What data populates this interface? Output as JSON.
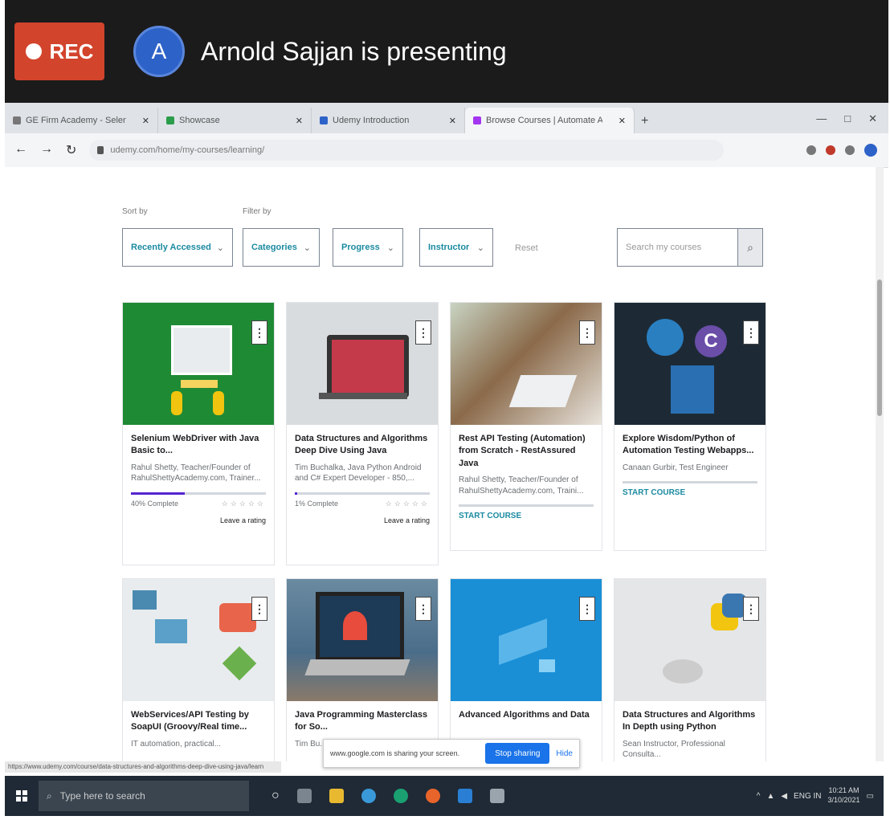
{
  "meeting": {
    "rec_label": "REC",
    "avatar_letter": "A",
    "presenting_text": "Arnold Sajjan is presenting"
  },
  "browser": {
    "tabs": [
      {
        "title": "GE Firm Academy - Selenium Co...",
        "active": false
      },
      {
        "title": "Showcase",
        "active": false
      },
      {
        "title": "Udemy Introduction",
        "active": false
      },
      {
        "title": "Browse Courses | Automate Aspir...",
        "active": true
      }
    ],
    "new_tab": "+",
    "url": "udemy.com/home/my-courses/learning/"
  },
  "filters": {
    "sort_label": "Sort by",
    "filter_label": "Filter by",
    "sort_value": "Recently Accessed",
    "categories": "Categories",
    "progress": "Progress",
    "instructor": "Instructor",
    "reset": "Reset",
    "search_placeholder": "Search my courses"
  },
  "courses": [
    {
      "title": "Selenium WebDriver with Java Basic to...",
      "author": "Rahul Shetty, Teacher/Founder of RahulShettyAcademy.com, Trainer...",
      "progress_pct": 40,
      "status": "40% Complete",
      "rating_label": "Leave a rating",
      "thumb_color": "#1f8a34"
    },
    {
      "title": "Data Structures and Algorithms Deep Dive Using Java",
      "author": "Tim Buchalka, Java Python Android and C# Expert Developer - 850,...",
      "progress_pct": 1,
      "status": "1% Complete",
      "rating_label": "Leave a rating",
      "thumb_color": "#d9dcdf"
    },
    {
      "title": "Rest API Testing (Automation) from Scratch - RestAssured Java",
      "author": "Rahul Shetty, Teacher/Founder of RahulShettyAcademy.com, Traini...",
      "progress_pct": 0,
      "status": "START COURSE",
      "rating_label": "",
      "thumb_color": "#8a6a4a"
    },
    {
      "title": "Explore Wisdom/Python of Automation Testing Webapps...",
      "author": "Canaan Gurbir, Test Engineer",
      "progress_pct": 0,
      "status": "START COURSE",
      "rating_label": "",
      "thumb_color": "#1d2a36"
    },
    {
      "title": "WebServices/API Testing by SoapUI (Groovy/Real time...",
      "author": "IT automation, practical...",
      "thumb_color": "#e8ecef"
    },
    {
      "title": "Java Programming Masterclass for So...",
      "author": "Tim Bu...",
      "thumb_color": "#4a6d8a"
    },
    {
      "title": "Advanced Algorithms and Data",
      "author": "",
      "thumb_color": "#1a8fd6"
    },
    {
      "title": "Data Structures and Algorithms In Depth using Python",
      "author": "Sean Instructor, Professional Consulta...",
      "thumb_color": "#e4e6e8"
    }
  ],
  "share_banner": {
    "text": "www.google.com is sharing your screen.",
    "stop": "Stop sharing",
    "hide": "Hide"
  },
  "status_url": "https://www.udemy.com/course/data-structures-and-algorithms-deep-dive-using-java/learn",
  "taskbar": {
    "search_placeholder": "Type here to search",
    "time": "10:21 AM",
    "date": "3/10/2021",
    "lang": "ENG IN"
  },
  "colors": {
    "rec": "#d2442c",
    "avatar": "#2d62c8",
    "accent": "#1a8aa0",
    "stop_button": "#1a73e8"
  }
}
